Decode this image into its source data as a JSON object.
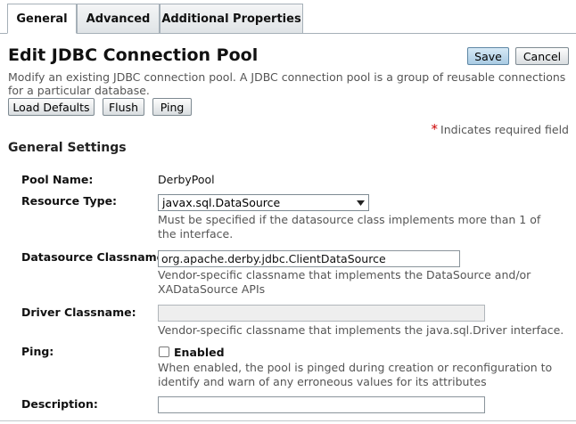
{
  "tabs": [
    {
      "label": "General",
      "active": true
    },
    {
      "label": "Advanced",
      "active": false
    },
    {
      "label": "Additional Properties",
      "active": false
    }
  ],
  "page": {
    "title": "Edit JDBC Connection Pool",
    "description": "Modify an existing JDBC connection pool. A JDBC connection pool is a group of reusable connections for a particular database.",
    "required_note": "Indicates required field",
    "required_star": "*"
  },
  "buttons": {
    "save": "Save",
    "cancel": "Cancel",
    "load_defaults": "Load Defaults",
    "flush": "Flush",
    "ping": "Ping"
  },
  "section": {
    "title": "General Settings"
  },
  "fields": {
    "pool_name": {
      "label": "Pool Name:",
      "value": "DerbyPool"
    },
    "resource_type": {
      "label": "Resource Type:",
      "value": "javax.sql.DataSource",
      "help": "Must be specified if the datasource class implements more than 1 of the interface."
    },
    "datasource_classname": {
      "label": "Datasource Classname:",
      "value": "org.apache.derby.jdbc.ClientDataSource",
      "help": "Vendor-specific classname that implements the DataSource and/or XADataSource APIs"
    },
    "driver_classname": {
      "label": "Driver Classname:",
      "value": "",
      "help": "Vendor-specific classname that implements the java.sql.Driver interface."
    },
    "ping": {
      "label": "Ping:",
      "checkbox_label": "Enabled",
      "checked": false,
      "help": "When enabled, the pool is pinged during creation or reconfiguration to identify and warn of any erroneous values for its attributes"
    },
    "description": {
      "label": "Description:",
      "value": ""
    }
  },
  "colors": {
    "primary_button": "#a9cbe3",
    "required_star": "#cc0000",
    "help_text": "#555555"
  }
}
